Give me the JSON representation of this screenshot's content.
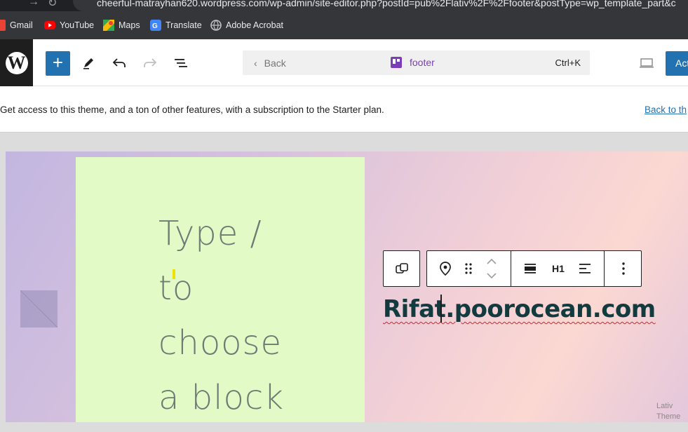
{
  "browser": {
    "url": "cheerful-matrayhan620.wordpress.com/wp-admin/site-editor.php?postId=pub%2Flativ%2F%2Ffooter&postType=wp_template_part&c",
    "bookmarks": [
      {
        "label": "Gmail",
        "icon": "gmail-icon",
        "color": "#ea4335"
      },
      {
        "label": "YouTube",
        "icon": "youtube-icon",
        "color": "#ff0000"
      },
      {
        "label": "Maps",
        "icon": "maps-icon",
        "color": "#34a853"
      },
      {
        "label": "Translate",
        "icon": "translate-icon",
        "color": "#4285f4"
      },
      {
        "label": "Adobe Acrobat",
        "icon": "globe-icon",
        "color": "#bdc1c6"
      }
    ]
  },
  "toolbar": {
    "back_label": "Back",
    "doc_title": "footer",
    "shortcut": "Ctrl+K",
    "activate_label": "Act"
  },
  "notice": {
    "text": "Get access to this theme, and a ton of other features, with a subscription to the Starter plan.",
    "link": "Back to th"
  },
  "canvas": {
    "placeholder_lines": [
      "Type /",
      "to",
      "choose",
      "a block"
    ],
    "heading_text": "Rifat.poorocean.com",
    "heading_level": "H1",
    "credit_lines": [
      "Lativ",
      "Theme"
    ]
  },
  "colors": {
    "accent": "#2271b1",
    "template_part": "#7a3fb8",
    "heading": "#123b3f",
    "green_block": "#e2fbc6"
  }
}
